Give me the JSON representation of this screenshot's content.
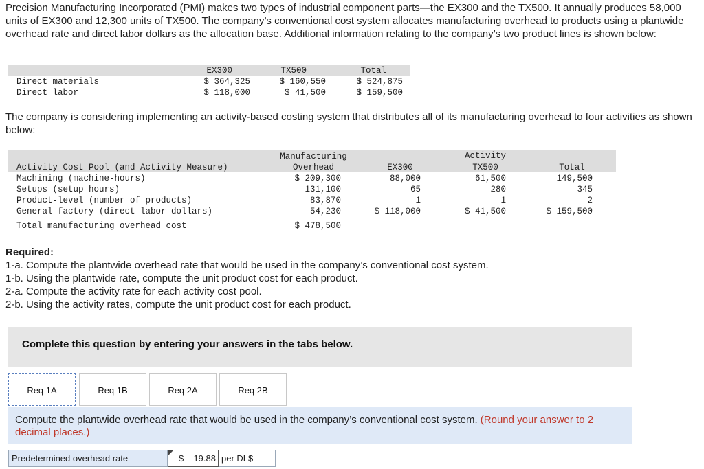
{
  "intro_text": "Precision Manufacturing Incorporated (PMI) makes two types of industrial component parts—the EX300 and the TX500. It annually produces 58,000 units of EX300 and 12,300 units of TX500. The company’s conventional cost system allocates manufacturing overhead to products using a plantwide overhead rate and direct labor dollars as the allocation base. Additional information relating to the company’s two product lines is shown below:",
  "table1": {
    "headers": [
      "EX300",
      "TX500",
      "Total"
    ],
    "rows": [
      {
        "label": "Direct materials",
        "values": [
          "$ 364,325",
          "$ 160,550",
          "$ 524,875"
        ]
      },
      {
        "label": "Direct labor",
        "values": [
          "$ 118,000",
          "$ 41,500",
          "$ 159,500"
        ]
      }
    ]
  },
  "para2": "The company is considering implementing an activity-based costing system that distributes all of its manufacturing overhead to four activities as shown below:",
  "table2": {
    "head_mo_1": "Manufacturing",
    "head_mo_2": "Overhead",
    "head_activity": "Activity",
    "head_pool": "Activity Cost Pool (and Activity Measure)",
    "head_ex": "EX300",
    "head_tx": "TX500",
    "head_total": "Total",
    "rows": [
      {
        "label": "Machining (machine-hours)",
        "mo": "$ 209,300",
        "ex": "88,000",
        "tx": "61,500",
        "total": "149,500"
      },
      {
        "label": "Setups (setup hours)",
        "mo": "131,100",
        "ex": "65",
        "tx": "280",
        "total": "345"
      },
      {
        "label": "Product-level (number of products)",
        "mo": "83,870",
        "ex": "1",
        "tx": "1",
        "total": "2"
      },
      {
        "label": "General factory (direct labor dollars)",
        "mo": "54,230",
        "ex": "$ 118,000",
        "tx": "$ 41,500",
        "total": "$ 159,500"
      }
    ],
    "total_label": "Total manufacturing overhead cost",
    "total_value": "$ 478,500"
  },
  "required": {
    "title": "Required:",
    "items": [
      "1-a. Compute the plantwide overhead rate that would be used in the company’s conventional cost system.",
      "1-b. Using the plantwide rate, compute the unit product cost for each product.",
      "2-a. Compute the activity rate for each activity cost pool.",
      "2-b. Using the activity rates, compute the unit product cost for each product."
    ]
  },
  "banner_text": "Complete this question by entering your answers in the tabs below.",
  "tabs": [
    "Req 1A",
    "Req 1B",
    "Req 2A",
    "Req 2B"
  ],
  "active_tab": "Req 1A",
  "instruction": "Compute the plantwide overhead rate that would be used in the company’s conventional cost system.",
  "instruction_note": "(Round your answer to 2 decimal places.)",
  "answer": {
    "label": "Predetermined overhead rate",
    "currency": "$",
    "value": "19.88",
    "unit": "per DL$"
  }
}
